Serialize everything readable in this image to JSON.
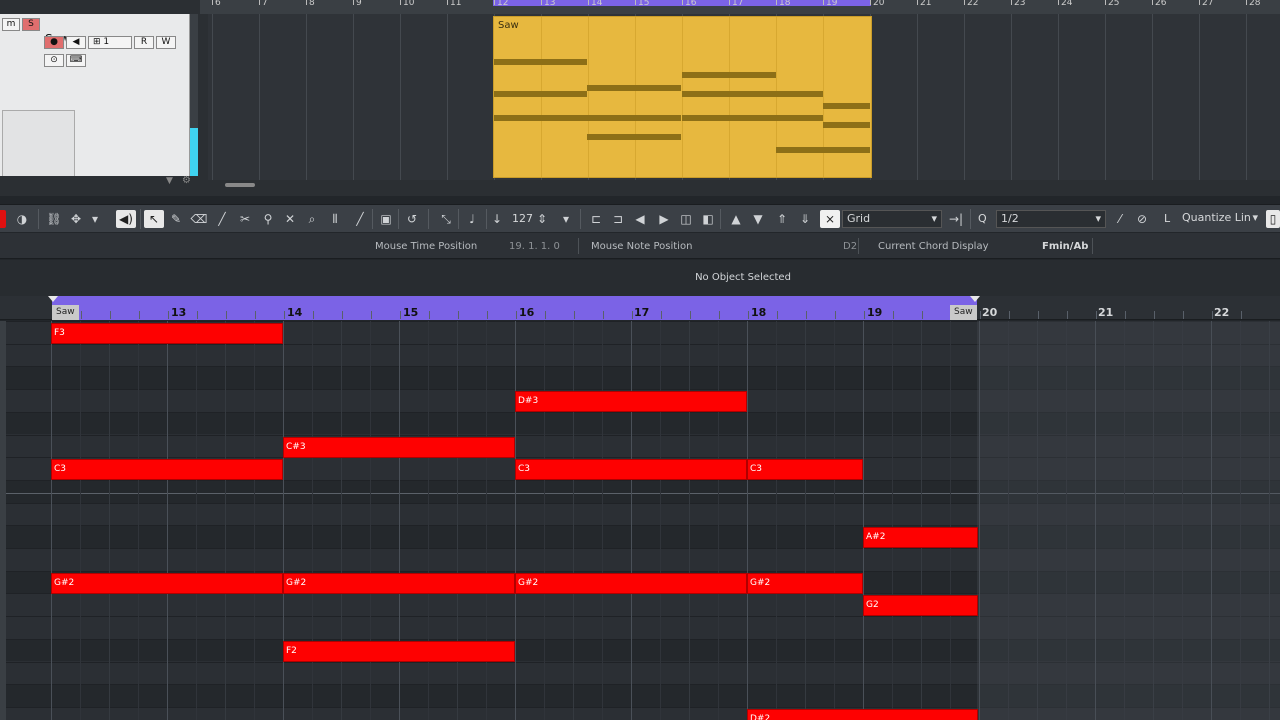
{
  "arrange": {
    "track_name": "Saw",
    "part_name": "Saw",
    "ruler_numbers": [
      "6",
      "7",
      "8",
      "9",
      "10",
      "11",
      "12",
      "13",
      "14",
      "15",
      "16",
      "17",
      "18",
      "19",
      "20",
      "21",
      "22",
      "23",
      "24",
      "25",
      "26",
      "27",
      "28"
    ],
    "inspector_buttons": {
      "mute": "m",
      "solo": "S",
      "channel": "1",
      "read": "R",
      "write": "W"
    }
  },
  "toolbar": {
    "velocity": "127",
    "snap_type": "Grid",
    "quantize": "1/2",
    "quantize_length": "Quantize Lin",
    "q_label": "Q",
    "l_label": "L"
  },
  "infoline": {
    "mouse_time_label": "Mouse Time Position",
    "mouse_time_value": "19. 1. 1.   0",
    "mouse_note_label": "Mouse Note Position",
    "mouse_note_value": "D2",
    "chord_label": "Current Chord Display",
    "chord_value": "Fmin/Ab"
  },
  "status": {
    "text": "No Object Selected"
  },
  "key_ruler": {
    "bars": [
      "13",
      "14",
      "15",
      "16",
      "17",
      "18",
      "19",
      "20",
      "21",
      "22"
    ],
    "loop_start_tag": "Saw",
    "loop_end_tag": "Saw"
  },
  "notes": {
    "n1": "F3",
    "n2": "D#3",
    "n3": "C#3",
    "n4": "C3",
    "n5": "C3",
    "n6": "C3",
    "n7": "A#2",
    "n8": "G#2",
    "n9": "G#2",
    "n10": "G#2",
    "n11": "G#2",
    "n12": "G2",
    "n13": "F2",
    "n14": "D#2"
  },
  "colors": {
    "note": "#fe0101",
    "loop": "#7b63e6",
    "part": "#e7b83f",
    "accent": "#3fd3f0"
  }
}
